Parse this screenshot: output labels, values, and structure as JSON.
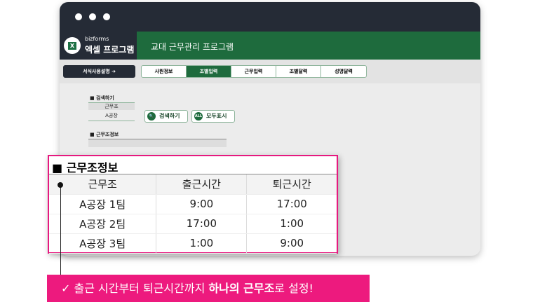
{
  "window": {
    "logo_brand": "bizforms",
    "logo_name": "엑셀 프로그램",
    "logo_icon_text": "X",
    "title": "교대 근무관리 프로그램"
  },
  "toolbar": {
    "guide": "서식사용설명 ➔",
    "tabs": [
      "사원정보",
      "조별입력",
      "근무입력",
      "조별달력",
      "성명달력"
    ],
    "active_tab": 1
  },
  "search": {
    "heading": "■ 검색하기",
    "label": "근무조",
    "value": "A공장",
    "search_button": "검색하기",
    "show_all_button": "모두표시",
    "all_icon_text": "ALL"
  },
  "info": {
    "heading": "■ 근무조정보",
    "columns": [
      "근무조",
      "출근시간",
      "퇴근시간"
    ],
    "rows": [
      [
        "A공장 1팀",
        "9:00",
        "17:00"
      ],
      [
        "A공장 2팀",
        "17:00",
        "1:00"
      ],
      [
        "A공장 3팀",
        "1:00",
        "9:00"
      ]
    ]
  },
  "callout": {
    "title": "■ 근무조정보"
  },
  "banner": {
    "check": "✓",
    "text1": "출근 시간부터 퇴근시간까지 ",
    "bold": "하나의 근무조",
    "text2": "로 설정!"
  },
  "colors": {
    "accent": "#ed1a7e",
    "green": "#1e6b3d",
    "dark": "#252b36"
  }
}
